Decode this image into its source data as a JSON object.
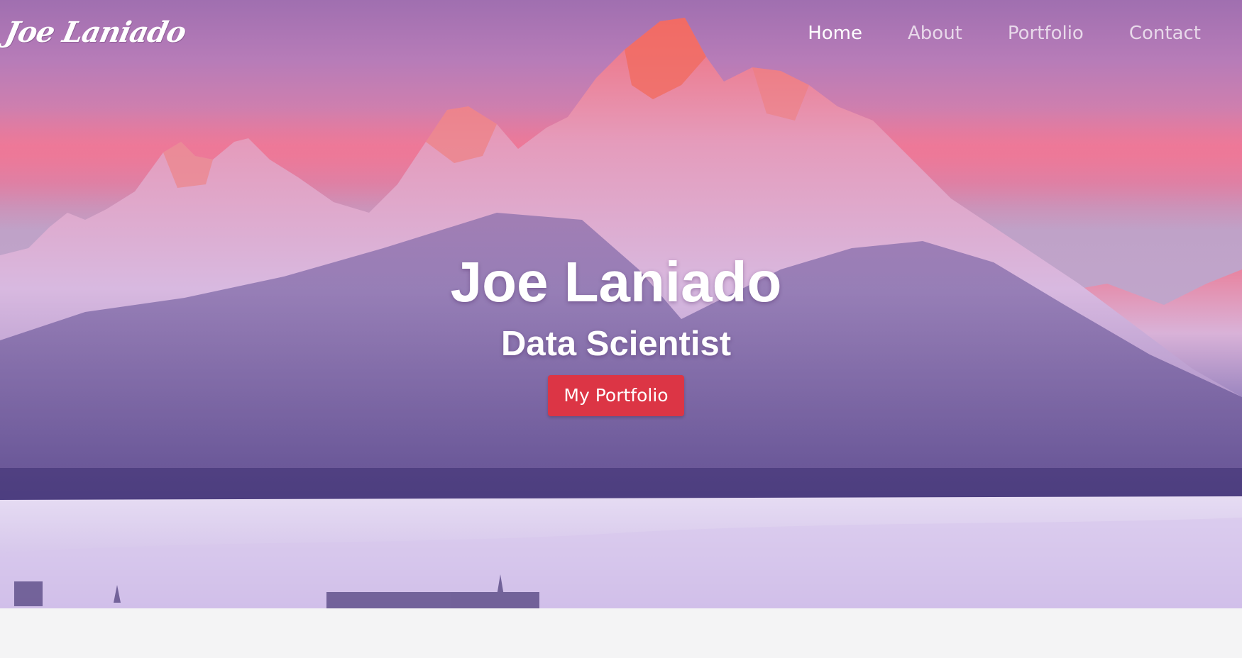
{
  "site": {
    "logo_text": "Joe Laniado"
  },
  "nav": {
    "items": [
      {
        "label": "Home",
        "active": true
      },
      {
        "label": "About",
        "active": false
      },
      {
        "label": "Portfolio",
        "active": false
      },
      {
        "label": "Contact",
        "active": false
      }
    ]
  },
  "hero": {
    "name": "Joe Laniado",
    "role": "Data Scientist",
    "cta_label": "My Portfolio",
    "background_image": "snowy-mountain-range-at-sunset"
  },
  "colors": {
    "accent": "#dc3545",
    "text": "#ffffff",
    "page_background": "#f4f4f5"
  }
}
